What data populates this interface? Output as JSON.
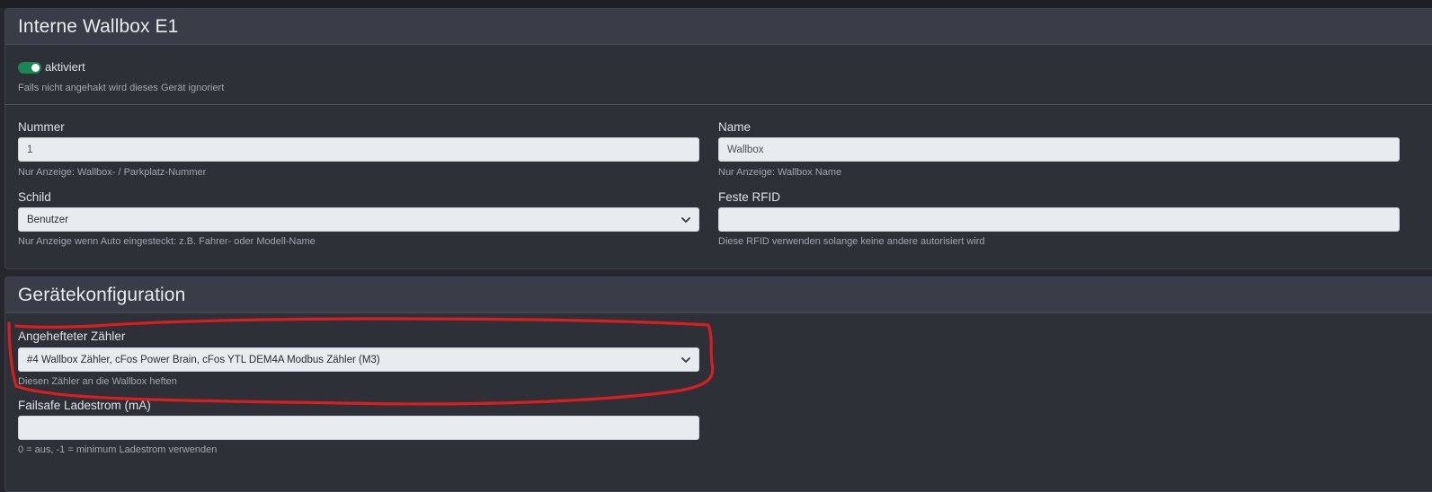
{
  "card1": {
    "title": "Interne Wallbox E1",
    "enabled_label": "aktiviert",
    "enabled_hint": "Falls nicht angehakt wird dieses Gerät ignoriert",
    "enabled_checked": true,
    "nummer": {
      "label": "Nummer",
      "value": "1",
      "hint": "Nur Anzeige: Wallbox- / Parkplatz-Nummer"
    },
    "name": {
      "label": "Name",
      "value": "Wallbox",
      "hint": "Nur Anzeige: Wallbox Name"
    },
    "schild": {
      "label": "Schild",
      "selected": "Benutzer",
      "hint": "Nur Anzeige wenn Auto eingesteckt: z.B. Fahrer- oder Modell-Name"
    },
    "rfid": {
      "label": "Feste RFID",
      "value": "",
      "hint": "Diese RFID verwenden solange keine andere autorisiert wird"
    }
  },
  "card2": {
    "title": "Gerätekonfiguration",
    "meter": {
      "label": "Angehefteter Zähler",
      "selected": "#4 Wallbox Zähler, cFos Power Brain, cFos YTL DEM4A Modbus Zähler (M3)",
      "hint": "Diesen Zähler an die Wallbox heften"
    },
    "failsafe": {
      "label": "Failsafe Ladestrom (mA)",
      "value": "",
      "hint": "0 = aus, -1 = minimum Ladestrom verwenden"
    }
  },
  "colors": {
    "background": "#26272e",
    "card": "#2e3038",
    "card_header": "#3a3d47",
    "toggle_on": "#198754",
    "annotation": "#d81e1e"
  },
  "icons": {
    "select_arrow": "chevron-down-icon"
  }
}
